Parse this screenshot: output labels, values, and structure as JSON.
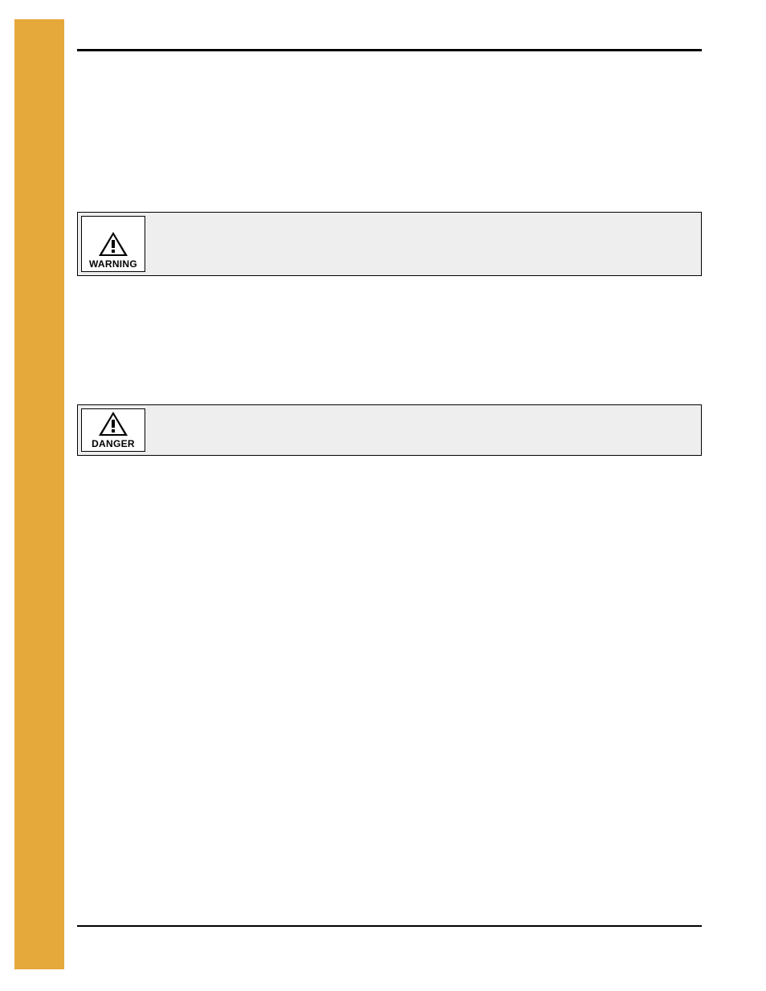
{
  "callouts": [
    {
      "label": "WARNING"
    },
    {
      "label": "DANGER"
    }
  ]
}
